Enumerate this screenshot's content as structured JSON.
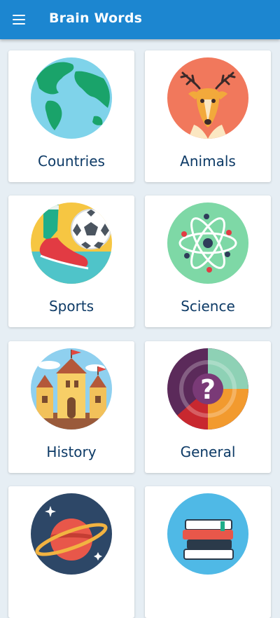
{
  "appbar": {
    "title": "Brain Words",
    "menu_icon": "menu-icon"
  },
  "categories": [
    {
      "label": "Countries",
      "icon": "globe-icon"
    },
    {
      "label": "Animals",
      "icon": "deer-icon"
    },
    {
      "label": "Sports",
      "icon": "soccer-icon"
    },
    {
      "label": "Science",
      "icon": "atom-icon"
    },
    {
      "label": "History",
      "icon": "castle-icon"
    },
    {
      "label": "General",
      "icon": "question-icon"
    },
    {
      "label": "",
      "icon": "planet-icon"
    },
    {
      "label": "",
      "icon": "books-icon"
    }
  ],
  "colors": {
    "appbar": "#1c86d0",
    "label": "#0d3a66",
    "background": "#e6eef4"
  }
}
